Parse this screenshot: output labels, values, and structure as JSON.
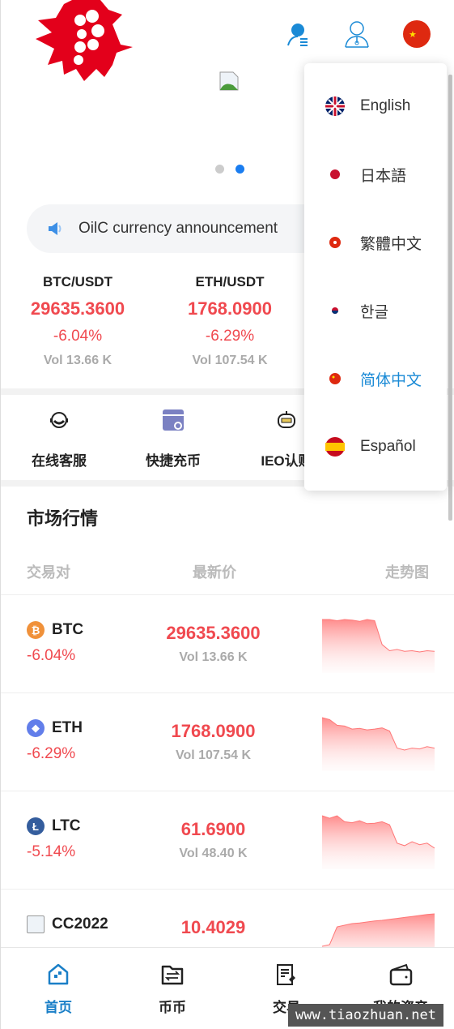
{
  "header": {
    "logo": "logo",
    "icons": [
      "user-list-icon",
      "customer-service-icon",
      "china-flag-icon"
    ]
  },
  "banner": {
    "dots": 2,
    "active_dot": 2
  },
  "announcement": {
    "icon": "speaker-icon",
    "text": "OilC currency announcement"
  },
  "tickers": [
    {
      "pair": "BTC/USDT",
      "price": "29635.3600",
      "change": "-6.04%",
      "vol": "Vol 13.66 K"
    },
    {
      "pair": "ETH/USDT",
      "price": "1768.0900",
      "change": "-6.29%",
      "vol": "Vol 107.54 K"
    }
  ],
  "quick_links": [
    {
      "label": "在线客服",
      "icon": "headset-icon"
    },
    {
      "label": "快捷充币",
      "icon": "deposit-icon"
    },
    {
      "label": "IEO认购",
      "icon": "robot-icon"
    }
  ],
  "market": {
    "title": "市场行情",
    "headers": [
      "交易对",
      "最新价",
      "走势图"
    ],
    "rows": [
      {
        "symbol": "BTC",
        "change": "-6.04%",
        "price": "29635.3600",
        "vol": "Vol 13.66 K",
        "color": "#f0913a",
        "glyph": "₿",
        "trend": [
          9,
          9,
          8.8,
          9,
          8.9,
          8.7,
          9,
          8.8,
          5,
          4,
          4.2,
          3.9,
          4,
          3.8,
          4,
          3.9
        ]
      },
      {
        "symbol": "ETH",
        "change": "-6.29%",
        "price": "1768.0900",
        "vol": "Vol 107.54 K",
        "color": "#627eea",
        "glyph": "◆",
        "trend": [
          10,
          9.5,
          8,
          7.8,
          7,
          7.2,
          6.8,
          7,
          7.3,
          6.5,
          2,
          1.5,
          2,
          1.8,
          2.4,
          2
        ]
      },
      {
        "symbol": "LTC",
        "change": "-5.14%",
        "price": "61.6900",
        "vol": "Vol 48.40 K",
        "color": "#345d9d",
        "glyph": "Ł",
        "trend": [
          9,
          8.5,
          9,
          7.8,
          7.6,
          8,
          7.4,
          7.5,
          7.8,
          7.2,
          3.5,
          3,
          3.8,
          3.2,
          3.5,
          2.5
        ]
      },
      {
        "symbol": "CC2022",
        "change": "",
        "price": "10.4029",
        "vol": "",
        "color": "#aaa",
        "glyph": "",
        "trend": [
          0,
          0.5,
          6,
          6.5,
          7,
          7.2,
          7.5,
          7.8,
          8,
          8.3,
          8.6,
          8.9,
          9.2,
          9.5,
          9.8,
          10
        ]
      }
    ]
  },
  "nav": [
    {
      "label": "首页",
      "icon": "home-icon",
      "active": true
    },
    {
      "label": "币币",
      "icon": "exchange-folder-icon"
    },
    {
      "label": "交易",
      "icon": "trade-document-icon"
    },
    {
      "label": "我的资产",
      "icon": "wallet-icon"
    }
  ],
  "languages": [
    {
      "label": "English",
      "flag": "uk-flag-icon"
    },
    {
      "label": "日本語",
      "flag": "japan-flag-icon"
    },
    {
      "label": "繁體中文",
      "flag": "hongkong-flag-icon"
    },
    {
      "label": "한글",
      "flag": "korea-flag-icon"
    },
    {
      "label": "简体中文",
      "flag": "china-flag-icon",
      "active": true
    },
    {
      "label": "Español",
      "flag": "spain-flag-icon"
    }
  ],
  "colors": {
    "accent": "#1a8ad6",
    "down": "#f0494f"
  },
  "watermark": "www.tiaozhuan.net"
}
